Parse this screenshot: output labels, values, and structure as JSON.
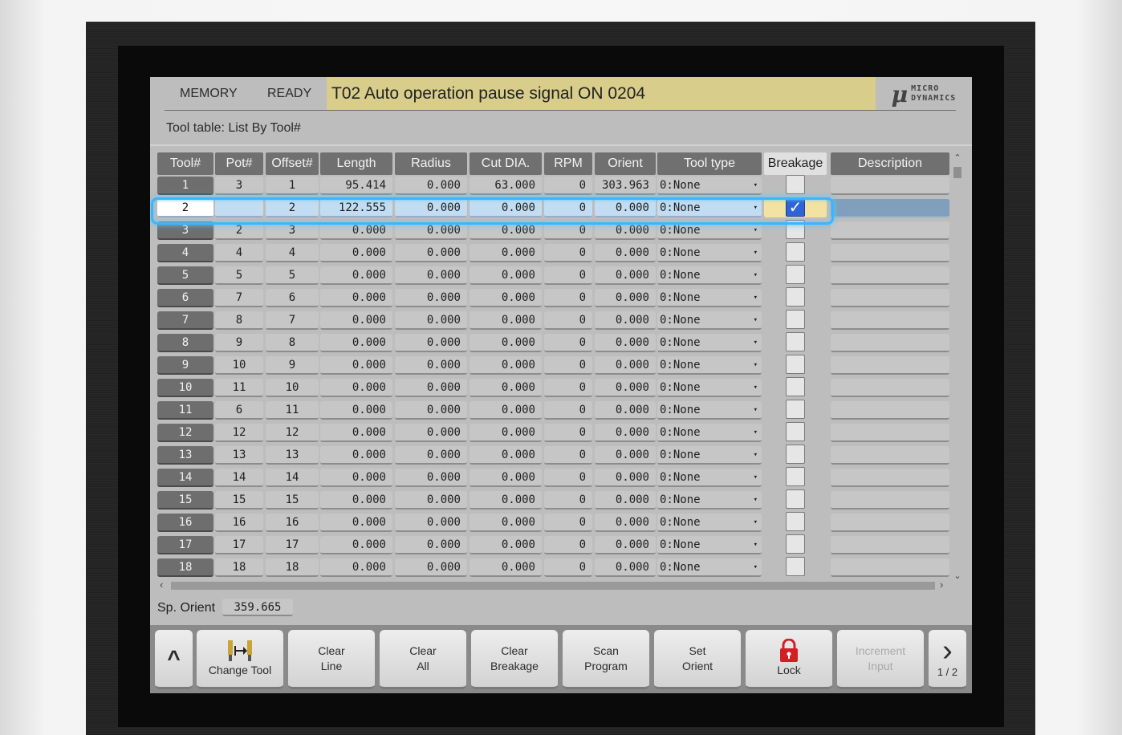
{
  "header": {
    "mode": "MEMORY",
    "status": "READY",
    "alarm": "T02  Auto operation pause signal ON 0204",
    "logo_symbol": "μ",
    "logo_line1": "MICRO",
    "logo_line2": "DYNAMICS"
  },
  "subtitle": "Tool table: List By Tool#",
  "table": {
    "columns": [
      "Tool#",
      "Pot#",
      "Offset#",
      "Length",
      "Radius",
      "Cut DIA.",
      "RPM",
      "Orient",
      "Tool type",
      "Breakage",
      "Description"
    ],
    "selected_row": 1,
    "rows": [
      {
        "tool": "1",
        "pot": "3",
        "offset": "1",
        "length": "95.414",
        "radius": "0.000",
        "cutdia": "63.000",
        "rpm": "0",
        "orient": "303.963",
        "type": "0:None",
        "breakage": false,
        "desc": ""
      },
      {
        "tool": "2",
        "pot": "",
        "offset": "2",
        "length": "122.555",
        "radius": "0.000",
        "cutdia": "0.000",
        "rpm": "0",
        "orient": "0.000",
        "type": "0:None",
        "breakage": true,
        "desc": ""
      },
      {
        "tool": "3",
        "pot": "2",
        "offset": "3",
        "length": "0.000",
        "radius": "0.000",
        "cutdia": "0.000",
        "rpm": "0",
        "orient": "0.000",
        "type": "0:None",
        "breakage": false,
        "desc": ""
      },
      {
        "tool": "4",
        "pot": "4",
        "offset": "4",
        "length": "0.000",
        "radius": "0.000",
        "cutdia": "0.000",
        "rpm": "0",
        "orient": "0.000",
        "type": "0:None",
        "breakage": false,
        "desc": ""
      },
      {
        "tool": "5",
        "pot": "5",
        "offset": "5",
        "length": "0.000",
        "radius": "0.000",
        "cutdia": "0.000",
        "rpm": "0",
        "orient": "0.000",
        "type": "0:None",
        "breakage": false,
        "desc": ""
      },
      {
        "tool": "6",
        "pot": "7",
        "offset": "6",
        "length": "0.000",
        "radius": "0.000",
        "cutdia": "0.000",
        "rpm": "0",
        "orient": "0.000",
        "type": "0:None",
        "breakage": false,
        "desc": ""
      },
      {
        "tool": "7",
        "pot": "8",
        "offset": "7",
        "length": "0.000",
        "radius": "0.000",
        "cutdia": "0.000",
        "rpm": "0",
        "orient": "0.000",
        "type": "0:None",
        "breakage": false,
        "desc": ""
      },
      {
        "tool": "8",
        "pot": "9",
        "offset": "8",
        "length": "0.000",
        "radius": "0.000",
        "cutdia": "0.000",
        "rpm": "0",
        "orient": "0.000",
        "type": "0:None",
        "breakage": false,
        "desc": ""
      },
      {
        "tool": "9",
        "pot": "10",
        "offset": "9",
        "length": "0.000",
        "radius": "0.000",
        "cutdia": "0.000",
        "rpm": "0",
        "orient": "0.000",
        "type": "0:None",
        "breakage": false,
        "desc": ""
      },
      {
        "tool": "10",
        "pot": "11",
        "offset": "10",
        "length": "0.000",
        "radius": "0.000",
        "cutdia": "0.000",
        "rpm": "0",
        "orient": "0.000",
        "type": "0:None",
        "breakage": false,
        "desc": ""
      },
      {
        "tool": "11",
        "pot": "6",
        "offset": "11",
        "length": "0.000",
        "radius": "0.000",
        "cutdia": "0.000",
        "rpm": "0",
        "orient": "0.000",
        "type": "0:None",
        "breakage": false,
        "desc": ""
      },
      {
        "tool": "12",
        "pot": "12",
        "offset": "12",
        "length": "0.000",
        "radius": "0.000",
        "cutdia": "0.000",
        "rpm": "0",
        "orient": "0.000",
        "type": "0:None",
        "breakage": false,
        "desc": ""
      },
      {
        "tool": "13",
        "pot": "13",
        "offset": "13",
        "length": "0.000",
        "radius": "0.000",
        "cutdia": "0.000",
        "rpm": "0",
        "orient": "0.000",
        "type": "0:None",
        "breakage": false,
        "desc": ""
      },
      {
        "tool": "14",
        "pot": "14",
        "offset": "14",
        "length": "0.000",
        "radius": "0.000",
        "cutdia": "0.000",
        "rpm": "0",
        "orient": "0.000",
        "type": "0:None",
        "breakage": false,
        "desc": ""
      },
      {
        "tool": "15",
        "pot": "15",
        "offset": "15",
        "length": "0.000",
        "radius": "0.000",
        "cutdia": "0.000",
        "rpm": "0",
        "orient": "0.000",
        "type": "0:None",
        "breakage": false,
        "desc": ""
      },
      {
        "tool": "16",
        "pot": "16",
        "offset": "16",
        "length": "0.000",
        "radius": "0.000",
        "cutdia": "0.000",
        "rpm": "0",
        "orient": "0.000",
        "type": "0:None",
        "breakage": false,
        "desc": ""
      },
      {
        "tool": "17",
        "pot": "17",
        "offset": "17",
        "length": "0.000",
        "radius": "0.000",
        "cutdia": "0.000",
        "rpm": "0",
        "orient": "0.000",
        "type": "0:None",
        "breakage": false,
        "desc": ""
      },
      {
        "tool": "18",
        "pot": "18",
        "offset": "18",
        "length": "0.000",
        "radius": "0.000",
        "cutdia": "0.000",
        "rpm": "0",
        "orient": "0.000",
        "type": "0:None",
        "breakage": false,
        "desc": ""
      }
    ]
  },
  "spindle": {
    "label": "Sp. Orient",
    "value": "359.665"
  },
  "toolbar": {
    "up_glyph": "^",
    "buttons": [
      {
        "name": "change-tool-button",
        "icon": "tool-change-icon",
        "lines": [
          "Change Tool"
        ],
        "enabled": true
      },
      {
        "name": "clear-line-button",
        "lines": [
          "Clear",
          "Line"
        ],
        "enabled": true
      },
      {
        "name": "clear-all-button",
        "lines": [
          "Clear",
          "All"
        ],
        "enabled": true
      },
      {
        "name": "clear-breakage-button",
        "lines": [
          "Clear",
          "Breakage"
        ],
        "enabled": true
      },
      {
        "name": "scan-program-button",
        "lines": [
          "Scan",
          "Program"
        ],
        "enabled": true
      },
      {
        "name": "set-orient-button",
        "lines": [
          "Set",
          "Orient"
        ],
        "enabled": true
      },
      {
        "name": "lock-button",
        "icon": "lock-icon",
        "lines": [
          "Lock"
        ],
        "enabled": true
      },
      {
        "name": "increment-input-button",
        "lines": [
          "Increment",
          "Input"
        ],
        "enabled": false
      }
    ],
    "next_glyph": "›",
    "page": "1 / 2"
  },
  "colors": {
    "alarm_bg": "#d8cd8a",
    "selection_glow": "#3ab6ff",
    "lock_icon": "#d21f26"
  }
}
